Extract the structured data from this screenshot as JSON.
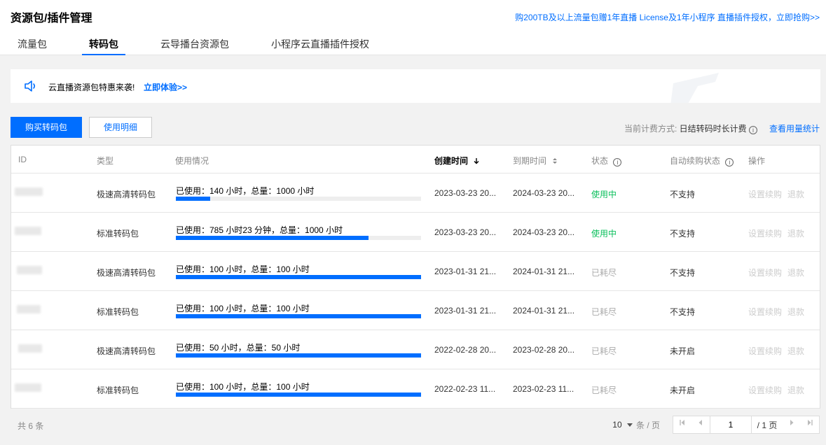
{
  "header": {
    "title": "资源包/插件管理",
    "promo": "购200TB及以上流量包赠1年直播 License及1年小程序 直播插件授权，立即抢购>>"
  },
  "tabs": [
    {
      "label": "流量包"
    },
    {
      "label": "转码包",
      "active": true
    },
    {
      "label": "云导播台资源包"
    },
    {
      "label": "小程序云直播插件授权"
    }
  ],
  "notice": {
    "text": "云直播资源包特惠来袭!",
    "link": "立即体验>>"
  },
  "toolbar": {
    "buy_label": "购买转码包",
    "detail_label": "使用明细",
    "billing_label": "当前计费方式:",
    "billing_value": "日结转码时长计费",
    "usage_link": "查看用量统计"
  },
  "table": {
    "columns": {
      "id": "ID",
      "type": "类型",
      "usage": "使用情况",
      "created": "创建时间",
      "expires": "到期时间",
      "status": "状态",
      "renew": "自动续购状态",
      "ops": "操作"
    },
    "rows": [
      {
        "type": "极速高清转码包",
        "usage": "已使用：140 小时，总量：1000 小时",
        "progress": 0.14,
        "created": "2023-03-23 20...",
        "expires": "2024-03-23 20...",
        "status": "使用中",
        "renew": "不支持",
        "op1": "设置续购",
        "op2": "退款"
      },
      {
        "type": "标准转码包",
        "usage": "已使用：785 小时23 分钟，总量：1000 小时",
        "progress": 0.785,
        "created": "2023-03-23 20...",
        "expires": "2024-03-23 20...",
        "status": "使用中",
        "renew": "不支持",
        "op1": "设置续购",
        "op2": "退款"
      },
      {
        "type": "极速高清转码包",
        "usage": "已使用：100 小时，总量：100 小时",
        "progress": 1.0,
        "created": "2023-01-31 21...",
        "expires": "2024-01-31 21...",
        "status": "已耗尽",
        "renew": "不支持",
        "op1": "设置续购",
        "op2": "退款"
      },
      {
        "type": "标准转码包",
        "usage": "已使用：100 小时，总量：100 小时",
        "progress": 1.0,
        "created": "2023-01-31 21...",
        "expires": "2024-01-31 21...",
        "status": "已耗尽",
        "renew": "不支持",
        "op1": "设置续购",
        "op2": "退款"
      },
      {
        "type": "极速高清转码包",
        "usage": "已使用：50 小时，总量：50 小时",
        "progress": 1.0,
        "created": "2022-02-28 20...",
        "expires": "2023-02-28 20...",
        "status": "已耗尽",
        "renew": "未开启",
        "op1": "设置续购",
        "op2": "退款"
      },
      {
        "type": "标准转码包",
        "usage": "已使用：100 小时，总量：100 小时",
        "progress": 1.0,
        "created": "2022-02-23 11...",
        "expires": "2023-02-23 11...",
        "status": "已耗尽",
        "renew": "未开启",
        "op1": "设置续购",
        "op2": "退款"
      }
    ]
  },
  "footer": {
    "count": "共 6 条",
    "page_size": "10",
    "page_size_label": "条 / 页",
    "page": "1",
    "total_pages": "/ 1 页"
  },
  "colors": {
    "accent": "#006eff",
    "active_status": "#0abf5b",
    "disabled": "#aaaaaa"
  }
}
